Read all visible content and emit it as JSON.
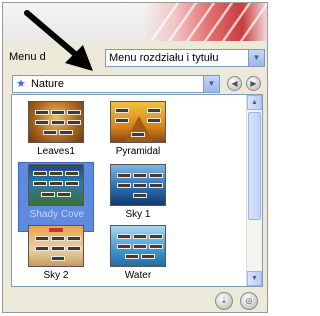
{
  "menu_row": {
    "label": "Menu d",
    "dropdown_value": "Menu rozdziału i tytułu"
  },
  "theme_row": {
    "dropdown_value": "Nature",
    "star_icon": "star-icon"
  },
  "themes": [
    {
      "name": "Leaves1"
    },
    {
      "name": "Pyramidal"
    },
    {
      "name": "Shady Cove"
    },
    {
      "name": "Sky 1"
    },
    {
      "name": "Sky 2"
    },
    {
      "name": "Water"
    }
  ],
  "selected_theme": "Shady Cove",
  "colors": {
    "selection": "#5e8be0",
    "banner_accent": "#c93c3c"
  }
}
